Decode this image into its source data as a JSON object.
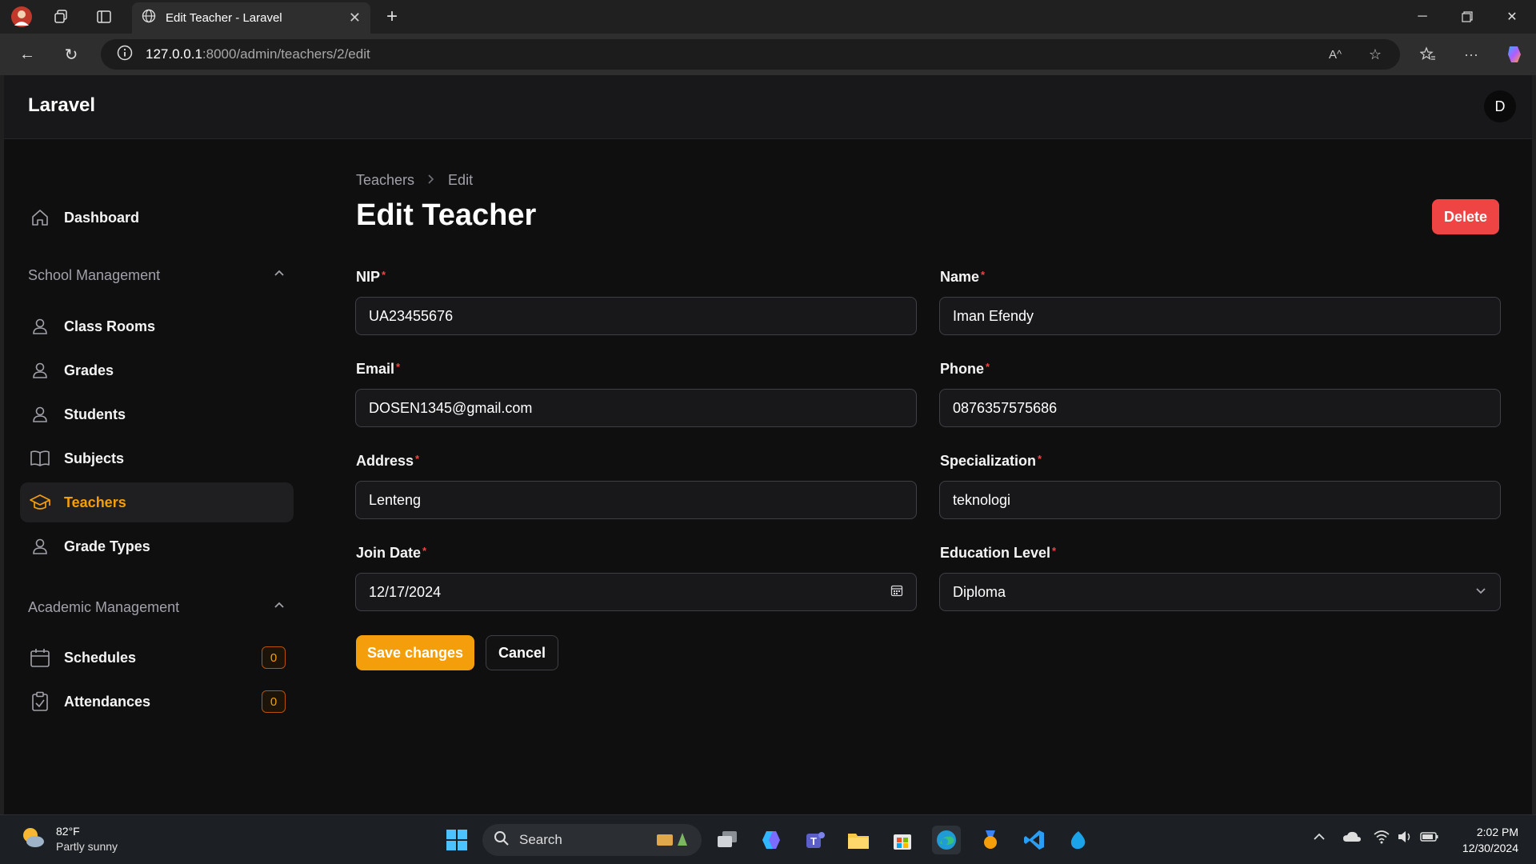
{
  "browser": {
    "tab_title": "Edit Teacher - Laravel",
    "url_host": "127.0.0.1",
    "url_path": ":8000/admin/teachers/2/edit"
  },
  "app": {
    "brand": "Laravel",
    "user_initial": "D"
  },
  "sidebar": {
    "dashboard": "Dashboard",
    "group_school": "School Management",
    "school_items": [
      {
        "label": "Class Rooms"
      },
      {
        "label": "Grades"
      },
      {
        "label": "Students"
      },
      {
        "label": "Subjects"
      },
      {
        "label": "Teachers"
      },
      {
        "label": "Grade Types"
      }
    ],
    "group_academic": "Academic Management",
    "academic_items": [
      {
        "label": "Schedules",
        "badge": "0"
      },
      {
        "label": "Attendances",
        "badge": "0"
      }
    ]
  },
  "page": {
    "breadcrumb_parent": "Teachers",
    "breadcrumb_current": "Edit",
    "title": "Edit Teacher",
    "delete_label": "Delete",
    "save_label": "Save changes",
    "cancel_label": "Cancel",
    "required_mark": "*"
  },
  "form": {
    "nip": {
      "label": "NIP",
      "value": "UA23455676"
    },
    "name": {
      "label": "Name",
      "value": "Iman Efendy"
    },
    "email": {
      "label": "Email",
      "value": "DOSEN1345@gmail.com"
    },
    "phone": {
      "label": "Phone",
      "value": "0876357575686"
    },
    "address": {
      "label": "Address",
      "value": "Lenteng"
    },
    "specialization": {
      "label": "Specialization",
      "value": "teknologi"
    },
    "join_date": {
      "label": "Join Date",
      "value": "12/17/2024"
    },
    "education_level": {
      "label": "Education Level",
      "value": "Diploma"
    }
  },
  "taskbar": {
    "temperature": "82°F",
    "weather": "Partly sunny",
    "search": "Search",
    "time": "2:02 PM",
    "date": "12/30/2024"
  },
  "colors": {
    "accent": "#f59e0b",
    "danger": "#ef4444",
    "background": "#0f0f0f"
  }
}
